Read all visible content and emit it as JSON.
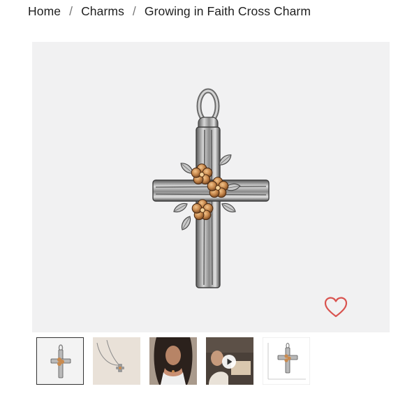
{
  "breadcrumb": {
    "items": [
      "Home",
      "Charms",
      "Growing in Faith Cross Charm"
    ],
    "separator": "/"
  },
  "product": {
    "image_icon": "cross-charm-with-flowers",
    "wishlist_icon": "heart-outline-icon",
    "wishlist_color": "#d9534f"
  },
  "gallery": {
    "thumbnails": [
      {
        "type": "product-image",
        "selected": true
      },
      {
        "type": "necklace-on-table",
        "selected": false
      },
      {
        "type": "model-wearing",
        "selected": false
      },
      {
        "type": "video",
        "icon": "play-icon",
        "selected": false
      },
      {
        "type": "size-chart",
        "selected": false
      }
    ]
  }
}
